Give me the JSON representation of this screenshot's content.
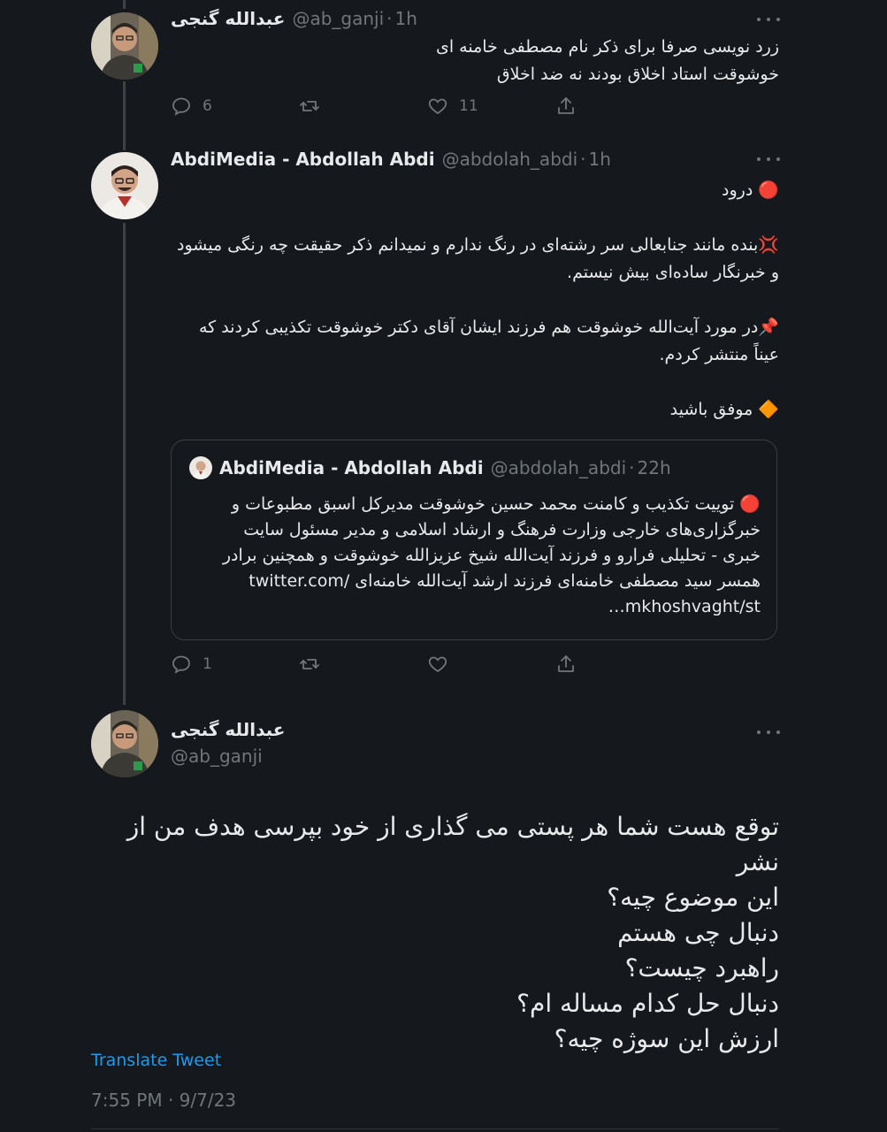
{
  "colors": {
    "background": "#15181c",
    "text": "#e7e9ea",
    "muted": "#71767b",
    "link": "#1d9bf0",
    "border": "#3a3d41"
  },
  "reply1": {
    "author_name": "عبدالله گنجی",
    "handle": "@ab_ganji",
    "time": "1h",
    "lines": [
      "زرد نویسی صرفا برای ذکر نام مصطفی خامنه ای",
      "خوشوقت استاد اخلاق بودند نه ضد اخلاق"
    ],
    "replies": "6",
    "retweets": "",
    "likes": "11"
  },
  "reply2": {
    "author_name": "AbdiMedia - Abdollah Abdi",
    "handle": "@abdolah_abdi",
    "time": "1h",
    "paragraphs": [
      "🔴 درود",
      "💢بنده مانند جنابعالی سر رشته‌ای در رنگ ندارم و نمیدانم ذکر حقیقت چه رنگی میشود و خبرنگار ساده‌ای بیش نیستم.",
      "📌در مورد آیت‌الله خوشوقت هم فرزند ایشان آقای دکتر خوشوقت تکذیبی کردند که عیناً منتشر کردم.",
      "🔶 موفق باشید"
    ],
    "quoted": {
      "author_name": "AbdiMedia - Abdollah Abdi",
      "handle": "@abdolah_abdi",
      "time": "22h",
      "lines": [
        "🔴 توییت تکذیب و کامنت محمد حسین خوشوقت مدیرکل اسبق مطبوعات و",
        "خبرگزاری‌های خارجی وزارت فرهنگ و ارشاد اسلامی و مدیر مسئول سایت",
        "خبری - تحلیلی فرارو و فرزند آیت‌الله شیخ عزیزالله خوشوقت و همچنین برادر",
        "همسر سید مصطفی خامنه‌ای فرزند ارشد آیت‌الله خامنه‌ای /twitter.com",
        "mkhoshvaght/st…"
      ]
    },
    "replies": "1",
    "retweets": "",
    "likes": ""
  },
  "main": {
    "author_name": "عبدالله گنجی",
    "handle": "@ab_ganji",
    "lines": [
      "توقع هست شما هر پستی می گذاری از خود بپرسی هدف من از نشر",
      "این موضوع چیه؟",
      "دنبال چی هستم",
      "راهبرد چیست؟",
      "دنبال حل کدام مساله ام؟",
      "ارزش این سوژه چیه؟"
    ],
    "translate_label": "Translate Tweet",
    "timestamp": "7:55 PM · 9/7/23"
  }
}
